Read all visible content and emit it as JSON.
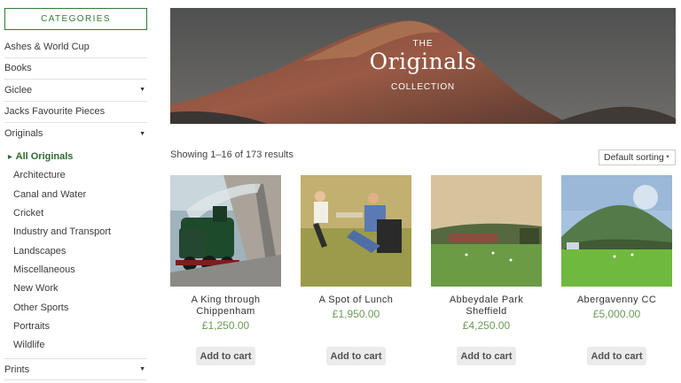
{
  "sidebar": {
    "header": "CATEGORIES",
    "items_before": [
      {
        "label": "Ashes & World Cup",
        "has_children": false
      },
      {
        "label": "Books",
        "has_children": false
      },
      {
        "label": "Giclee",
        "has_children": true
      },
      {
        "label": "Jacks Favourite Pieces",
        "has_children": false
      },
      {
        "label": "Originals",
        "has_children": true
      }
    ],
    "originals_sub": [
      "All Originals",
      "Architecture",
      "Canal and Water",
      "Cricket",
      "Industry and Transport",
      "Landscapes",
      "Miscellaneous",
      "New Work",
      "Other Sports",
      "Portraits",
      "Wildlife"
    ],
    "active_sub": "All Originals",
    "items_after": [
      {
        "label": "Prints",
        "has_children": true
      }
    ]
  },
  "banner": {
    "the": "THE",
    "title": "Originals",
    "collection": "COLLECTION"
  },
  "toolbar": {
    "result_count": "Showing 1–16 of 173 results",
    "sort_label": "Default sorting"
  },
  "products": [
    {
      "name": "A King through Chippenham",
      "price": "£1,250.00",
      "button": "Add to cart"
    },
    {
      "name": "A Spot of Lunch",
      "price": "£1,950.00",
      "button": "Add to cart"
    },
    {
      "name": "Abbeydale Park Sheffield",
      "price": "£4,250.00",
      "button": "Add to cart"
    },
    {
      "name": "Abergavenny CC",
      "price": "£5,000.00",
      "button": "Add to cart"
    }
  ]
}
